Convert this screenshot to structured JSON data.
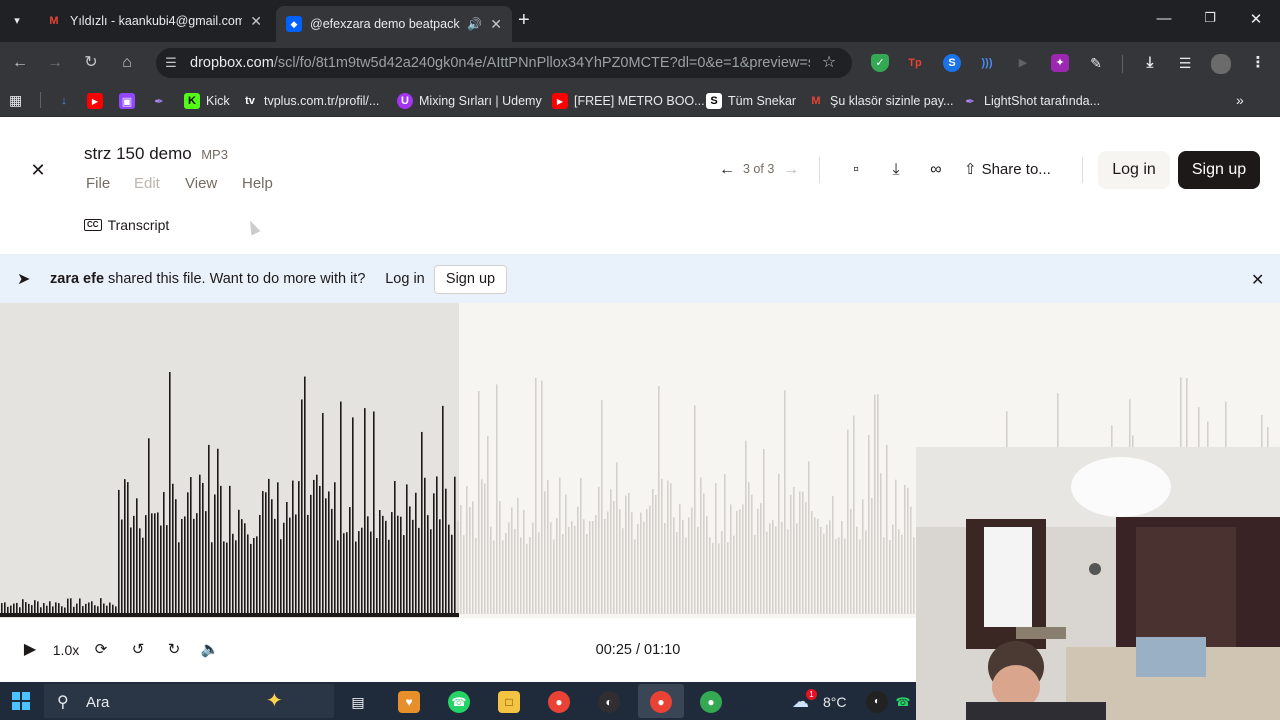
{
  "browser": {
    "tabs": [
      {
        "title": "Yıldızlı - kaankubi4@gmail.com",
        "favicon": "gmail-icon"
      },
      {
        "title": "@efexzara demo beatpack",
        "favicon": "dropbox-icon",
        "active": true
      }
    ],
    "url_host": "dropbox.com",
    "url_path": "/scl/fo/8t1m9tw5d42a240gk0n4e/AIttPNnPllox34YhPZ0MCTE?dl=0&e=1&preview=s...",
    "bookmarks": [
      {
        "label": "",
        "icon": "download-icon"
      },
      {
        "label": "",
        "icon": "youtube-icon"
      },
      {
        "label": "",
        "icon": "twitch-icon"
      },
      {
        "label": "",
        "icon": "feather-icon"
      },
      {
        "label": "Kick",
        "icon": "kick-icon"
      },
      {
        "label": "tvplus.com.tr/profil/...",
        "icon": "tvplus-icon"
      },
      {
        "label": "Mixing Sırları | Udemy",
        "icon": "udemy-icon"
      },
      {
        "label": "[FREE] METRO BOO...",
        "icon": "youtube-icon"
      },
      {
        "label": "Tüm Snekar",
        "icon": "snekar-icon"
      },
      {
        "label": "Şu klasör sizinle pay...",
        "icon": "gmail-icon"
      },
      {
        "label": "LightShot tarafında...",
        "icon": "feather-icon"
      }
    ]
  },
  "file": {
    "name": "strz 150 demo",
    "type": "MP3",
    "menu": [
      "File",
      "Edit",
      "View",
      "Help"
    ],
    "transcript": "Transcript",
    "position": "3 of 3",
    "share": "Share to...",
    "login": "Log in",
    "signup": "Sign up"
  },
  "banner": {
    "user": "zara efe",
    "message": "shared this file. Want to do more with it?",
    "login": "Log in",
    "signup": "Sign up"
  },
  "player": {
    "speed": "1.0x",
    "time": "00:25 / 01:10",
    "progress": 0.357
  },
  "taskbar": {
    "search": "Ara",
    "weather": "8°C",
    "notification_count": "1"
  },
  "colors": {
    "accent": "#1e1919",
    "banner_bg": "#e9f2fb",
    "wave_played": "#1e1919",
    "wave_unplayed": "#d4d1cc"
  }
}
